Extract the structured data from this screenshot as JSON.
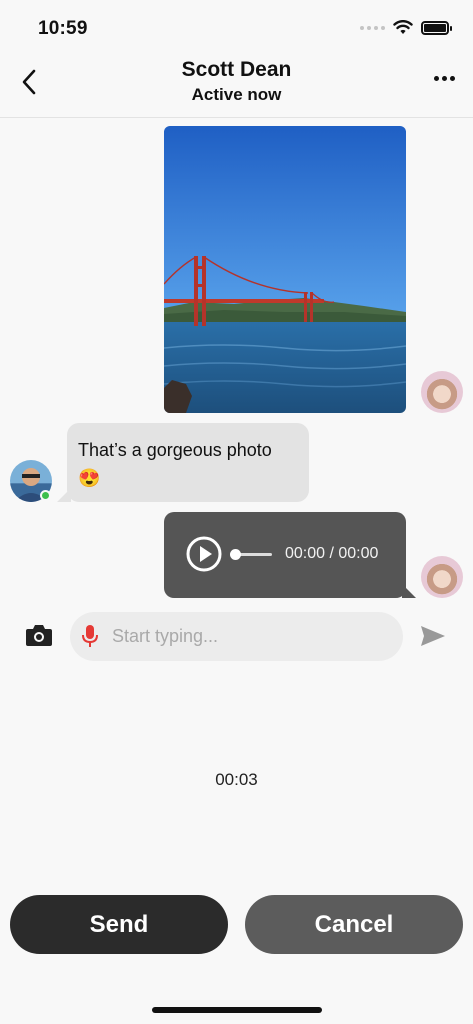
{
  "status_bar": {
    "time": "10:59"
  },
  "header": {
    "contact_name": "Scott Dean",
    "status": "Active now"
  },
  "messages": {
    "received_text": "That’s a gorgeous photo",
    "received_emoji": "😍",
    "voice_time": "00:00 / 00:00"
  },
  "composer": {
    "placeholder": "Start typing..."
  },
  "recording": {
    "timer": "00:03"
  },
  "actions": {
    "send_label": "Send",
    "cancel_label": "Cancel"
  },
  "colors": {
    "accent_mic": "#e53935",
    "online": "#3dbf4d",
    "sent_bubble": "#555555",
    "received_bubble": "#e3e3e3"
  }
}
